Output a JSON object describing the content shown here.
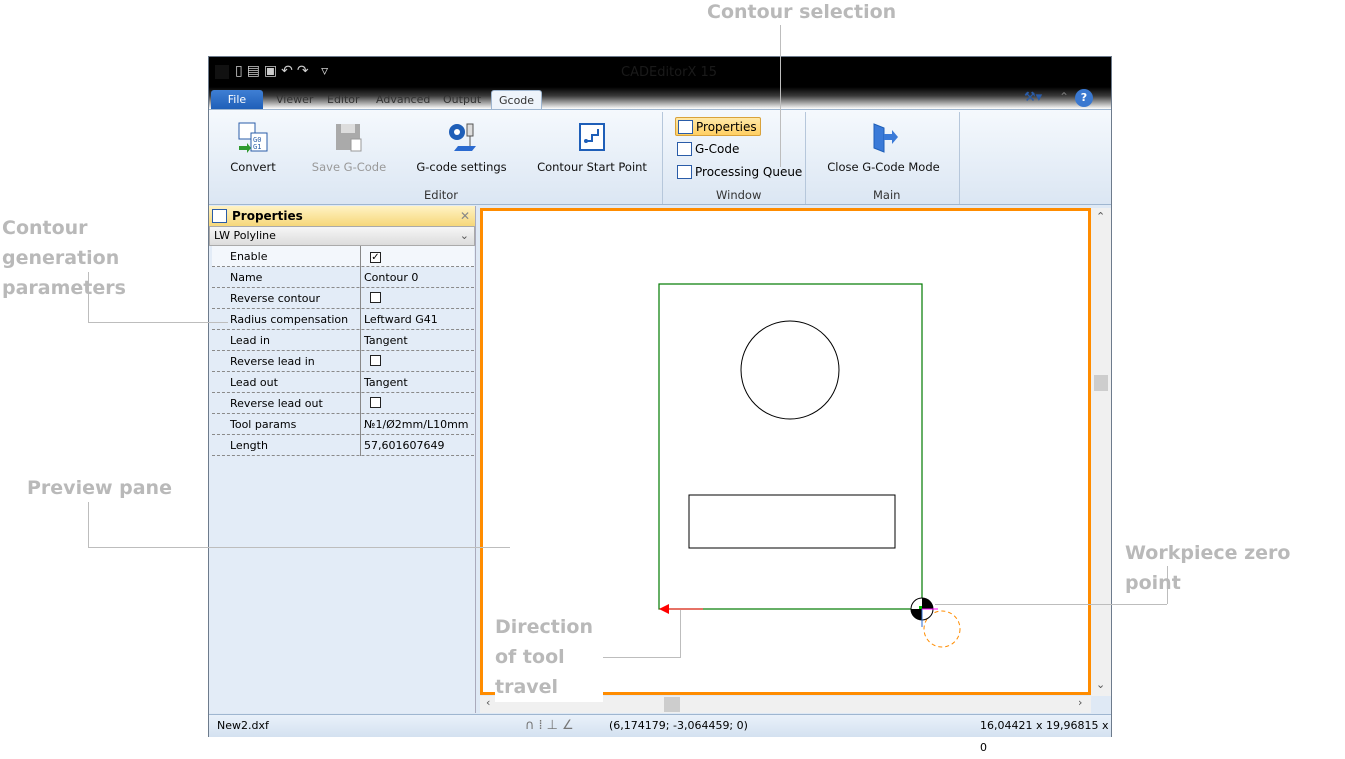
{
  "annotations": {
    "contour_selection": "Contour selection",
    "contour_generation_parameters": "Contour generation parameters",
    "preview_pane": "Preview pane",
    "workpiece_zero_point": "Workpiece zero point",
    "direction_of_tool_travel": "Direction of tool travel"
  },
  "window": {
    "title": "CADEditorX 15"
  },
  "tabs": [
    {
      "label": "File"
    },
    {
      "label": "Viewer"
    },
    {
      "label": "Editor"
    },
    {
      "label": "Advanced"
    },
    {
      "label": "Output"
    },
    {
      "label": "Gcode"
    }
  ],
  "active_tab": "Gcode",
  "ribbon": {
    "editor": {
      "label": "Editor",
      "convert": "Convert",
      "save_gcode": "Save G-Code",
      "gcode_settings": "G-code settings",
      "contour_start_point": "Contour Start Point"
    },
    "window": {
      "label": "Window",
      "properties": "Properties",
      "gcode": "G-Code",
      "processing_queue": "Processing Queue"
    },
    "main": {
      "label": "Main",
      "close_gcode_mode": "Close G-Code Mode"
    }
  },
  "properties": {
    "title": "Properties",
    "object_type": "LW Polyline",
    "rows": [
      {
        "key": "Enable",
        "value": "",
        "checkbox": true,
        "checked": true
      },
      {
        "key": "Name",
        "value": "Contour 0"
      },
      {
        "key": "Reverse contour",
        "value": "",
        "checkbox": true,
        "checked": false
      },
      {
        "key": "Radius compensation",
        "value": "Leftward G41"
      },
      {
        "key": "Lead in",
        "value": "Tangent"
      },
      {
        "key": "Reverse lead in",
        "value": "",
        "checkbox": true,
        "checked": false
      },
      {
        "key": "Lead out",
        "value": "Tangent"
      },
      {
        "key": "Reverse lead out",
        "value": "",
        "checkbox": true,
        "checked": false
      },
      {
        "key": "Tool params",
        "value": "№1/Ø2mm/L10mm"
      },
      {
        "key": "Length",
        "value": "57,601607649"
      }
    ]
  },
  "status": {
    "file": "New2.dxf",
    "coords": "(6,174179; -3,064459; 0)",
    "dimensions": "16,04421 x 19,96815 x 0"
  },
  "colors": {
    "accent": "#ff8c00",
    "contour": "#007a00",
    "direction_arrow": "#ff0000",
    "lead": "#ff8c00"
  }
}
